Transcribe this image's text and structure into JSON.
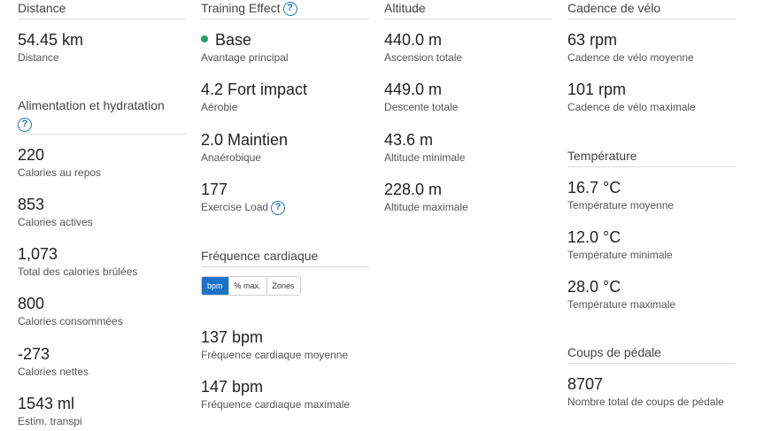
{
  "distance": {
    "title": "Distance",
    "items": [
      {
        "value": "54.45 km",
        "label": "Distance"
      }
    ]
  },
  "nutrition": {
    "title": "Alimentation et hydratation",
    "items": [
      {
        "value": "220",
        "label": "Calories au repos"
      },
      {
        "value": "853",
        "label": "Calories actives"
      },
      {
        "value": "1,073",
        "label": "Total des calories brûlées"
      },
      {
        "value": "800",
        "label": "Calories consommées"
      },
      {
        "value": "-273",
        "label": "Calories nettes"
      },
      {
        "value": "1543 ml",
        "label": "Estim. transpi"
      }
    ]
  },
  "training": {
    "title": "Training Effect",
    "items": [
      {
        "value": "Base",
        "label": "Avantage principal"
      },
      {
        "value": "4.2 Fort impact",
        "label": "Aérobie"
      },
      {
        "value": "2.0 Maintien",
        "label": "Anaérobique"
      },
      {
        "value": "177",
        "label": "Exercise Load"
      }
    ],
    "primary_color": "#1aa36b"
  },
  "heart": {
    "title": "Fréquence cardiaque",
    "tabs": [
      {
        "label": "bpm",
        "active": true
      },
      {
        "label": "% max.",
        "active": false
      },
      {
        "label": "Zones",
        "active": false
      }
    ],
    "items": [
      {
        "value": "137 bpm",
        "label": "Fréquence cardiaque moyenne"
      },
      {
        "value": "147 bpm",
        "label": "Fréquence cardiaque maximale"
      }
    ]
  },
  "altitude": {
    "title": "Altitude",
    "items": [
      {
        "value": "440.0 m",
        "label": "Ascension totale"
      },
      {
        "value": "449.0 m",
        "label": "Descente totale"
      },
      {
        "value": "43.6 m",
        "label": "Altitude minimale"
      },
      {
        "value": "228.0 m",
        "label": "Altitude maximale"
      }
    ]
  },
  "cadence": {
    "title": "Cadence de vélo",
    "items": [
      {
        "value": "63 rpm",
        "label": "Cadence de vélo moyenne"
      },
      {
        "value": "101 rpm",
        "label": "Cadence de vélo maximale"
      }
    ]
  },
  "temperature": {
    "title": "Température",
    "items": [
      {
        "value": "16.7 °C",
        "label": "Température moyenne"
      },
      {
        "value": "12.0 °C",
        "label": "Température minimale"
      },
      {
        "value": "28.0 °C",
        "label": "Température maximale"
      }
    ]
  },
  "strokes": {
    "title": "Coups de pédale",
    "items": [
      {
        "value": "8707",
        "label": "Nombre total de coups de pédale"
      }
    ]
  },
  "accent_color": "#1a73c8"
}
